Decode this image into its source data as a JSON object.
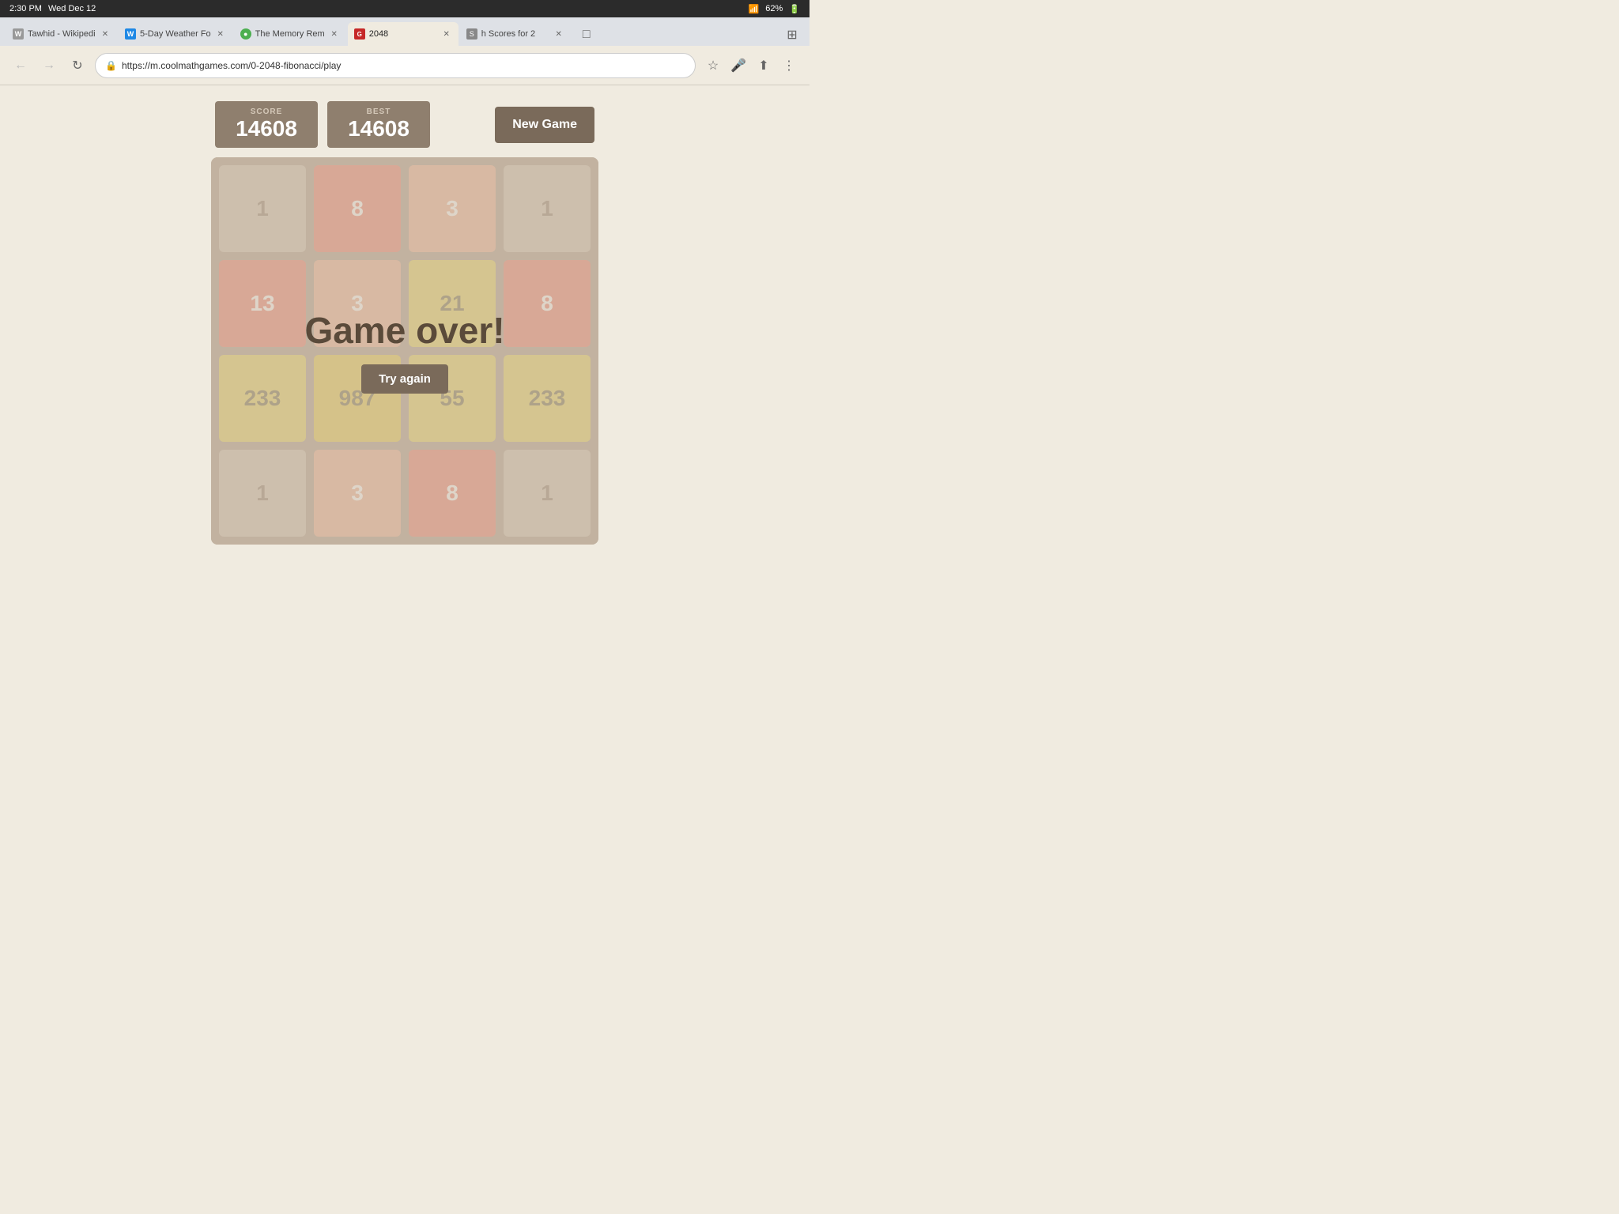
{
  "statusBar": {
    "time": "2:30 PM",
    "date": "Wed Dec 12",
    "battery": "62%",
    "batteryIcon": "🔋"
  },
  "tabs": [
    {
      "id": "tab-wiki",
      "favicon": "W",
      "faviconBg": "#999",
      "title": "Tawhid - Wikipedi",
      "active": false
    },
    {
      "id": "tab-weather",
      "favicon": "W",
      "faviconBg": "#1e88e5",
      "title": "5-Day Weather Fo",
      "active": false
    },
    {
      "id": "tab-memory",
      "favicon": "🟢",
      "faviconBg": "#4caf50",
      "title": "The Memory Rem",
      "active": false
    },
    {
      "id": "tab-2048",
      "favicon": "G",
      "faviconBg": "#e53935",
      "title": "2048",
      "active": true
    },
    {
      "id": "tab-scores",
      "favicon": "S",
      "faviconBg": "#888",
      "title": "h Scores for 2",
      "active": false
    }
  ],
  "addressBar": {
    "url": "https://m.coolmathgames.com/0-2048-fibonacci/play",
    "protocol": "https://",
    "domain": "m.coolmathgames.com",
    "path": "/0-2048-fibonacci/play"
  },
  "game": {
    "scoreLabel": "SCORE",
    "bestLabel": "BEST",
    "scoreValue": "14608",
    "bestValue": "14608",
    "newGameLabel": "New Game",
    "gameOverText": "Game over!",
    "tryAgainLabel": "Try again",
    "board": [
      [
        {
          "value": 1,
          "tileClass": "tile-1"
        },
        {
          "value": 8,
          "tileClass": "tile-8"
        },
        {
          "value": 3,
          "tileClass": "tile-3"
        },
        {
          "value": 1,
          "tileClass": "tile-1"
        }
      ],
      [
        {
          "value": 13,
          "tileClass": "tile-13"
        },
        {
          "value": 3,
          "tileClass": "tile-3"
        },
        {
          "value": 21,
          "tileClass": "tile-21"
        },
        {
          "value": 8,
          "tileClass": "tile-8"
        }
      ],
      [
        {
          "value": 233,
          "tileClass": "tile-233"
        },
        {
          "value": 987,
          "tileClass": "tile-987"
        },
        {
          "value": 55,
          "tileClass": "tile-55"
        },
        {
          "value": 233,
          "tileClass": "tile-233"
        }
      ],
      [
        {
          "value": 1,
          "tileClass": "tile-1"
        },
        {
          "value": 3,
          "tileClass": "tile-3"
        },
        {
          "value": 8,
          "tileClass": "tile-8"
        },
        {
          "value": 1,
          "tileClass": "tile-1"
        }
      ]
    ]
  }
}
